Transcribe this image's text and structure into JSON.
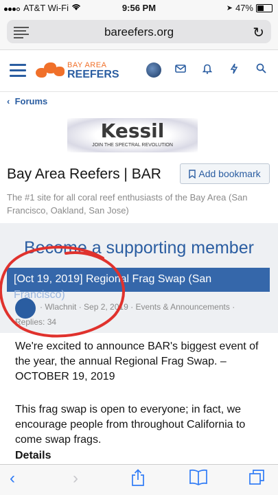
{
  "status_bar": {
    "carrier": "AT&T Wi-Fi",
    "time": "9:56 PM",
    "battery": "47%",
    "battery_level": 0.47
  },
  "browser": {
    "url": "bareefers.org"
  },
  "header": {
    "logo_line1": "BAY AREA",
    "logo_line2": "REEFERS",
    "icons": [
      "avatar",
      "mail-icon",
      "bell-icon",
      "bolt-icon",
      "search-icon"
    ]
  },
  "breadcrumb": {
    "label": "Forums"
  },
  "banner": {
    "brand": "Kessil",
    "tagline": "JOIN THE SPECTRAL REVOLUTION"
  },
  "forum": {
    "title": "Bay Area Reefers | BAR",
    "bookmark_label": "Add bookmark",
    "description": "The #1 site for all coral reef enthusiasts of the Bay Area (San Francisco, Oakland, San Jose)"
  },
  "promo": {
    "supporting": "Become a supporting member"
  },
  "thread": {
    "title_line1": "[Oct 19, 2019] Regional Frag Swap (San",
    "title_line2": "Francisco)",
    "author": "Wlachnit",
    "date": "Sep 2, 2019",
    "category": "Events & Announcements",
    "replies": "Replies: 34"
  },
  "post": {
    "paragraph1": "We're excited to announce BAR's biggest event of the year, the annual Regional Frag Swap. – OCTOBER 19, 2019",
    "paragraph2": "This frag swap is open to everyone; in fact, we encourage people from throughout California to come swap frags.",
    "details_heading": "Details"
  },
  "colors": {
    "brand_blue": "#2a5da1",
    "brand_orange": "#f0702a",
    "annotation_red": "#e0322d"
  }
}
